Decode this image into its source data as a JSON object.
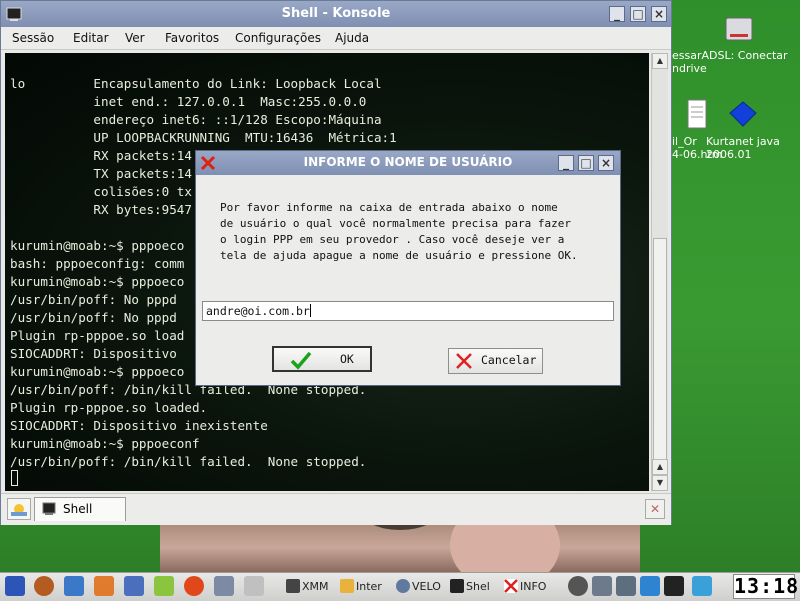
{
  "konsole": {
    "title": "Shell - Konsole",
    "menu": [
      "Sessão",
      "Editar",
      "Ver",
      "Favoritos",
      "Configurações",
      "Ajuda"
    ],
    "lines": [
      "lo         Encapsulamento do Link: Loopback Local",
      "           inet end.: 127.0.0.1  Masc:255.0.0.0",
      "           endereço inet6: ::1/128 Escopo:Máquina",
      "           UP LOOPBACKRUNNING  MTU:16436  Métrica:1",
      "           RX packets:14",
      "           TX packets:14",
      "           colisões:0 tx",
      "           RX bytes:9547",
      "",
      "kurumin@moab:~$ pppoeco",
      "bash: pppoeconfig: comm",
      "kurumin@moab:~$ pppoeco",
      "/usr/bin/poff: No pppd",
      "/usr/bin/poff: No pppd",
      "Plugin rp-pppoe.so load",
      "SIOCADDRT: Dispositivo",
      "kurumin@moab:~$ pppoeco",
      "/usr/bin/poff: /bin/kill failed.  None stopped.",
      "Plugin rp-pppoe.so loaded.",
      "SIOCADDRT: Dispositivo inexistente",
      "kurumin@moab:~$ pppoeconf",
      "/usr/bin/poff: /bin/kill failed.  None stopped."
    ],
    "tab_label": "Shell"
  },
  "dialog": {
    "title": "INFORME O NOME DE USUÁRIO",
    "message_lines": [
      "Por favor informe na caixa de entrada abaixo o nome",
      "de usuário o qual você normalmente precisa para fazer",
      "o login PPP em seu provedor . Caso você deseje ver a",
      "tela de ajuda apague a nome de usuário e pressione OK."
    ],
    "input_value": "andre@oi.com.br",
    "ok_label": "OK",
    "cancel_label": "Cancelar"
  },
  "desktop": {
    "icon1_label_line1": "essarADSL: Conectar",
    "icon1_label_line2": "ndrive",
    "icon2_label_line1": "il_Or",
    "icon2_label_line2": "4-06.htm",
    "icon3_label_line1": "Kurtanet java",
    "icon3_label_line2": "2006.01"
  },
  "taskbar": {
    "tasks": [
      "XMM",
      "Inter",
      "VELO",
      "Shel",
      "INFO"
    ],
    "clock": "13:18"
  },
  "colors": {
    "terminal_text": "#e8eedd",
    "titlebar": "#8595b8",
    "desktop": "#3a9a32"
  }
}
